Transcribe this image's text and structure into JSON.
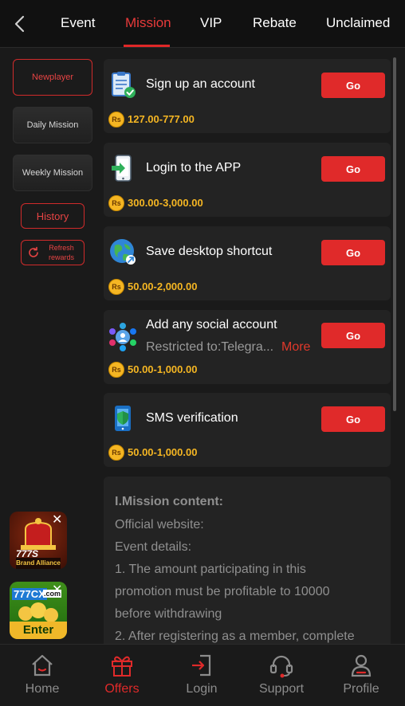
{
  "header": {
    "tabs": [
      {
        "label": "Event"
      },
      {
        "label": "Mission"
      },
      {
        "label": "VIP"
      },
      {
        "label": "Rebate"
      },
      {
        "label": "Unclaimed"
      }
    ],
    "active_tab": "Mission"
  },
  "sidebar": {
    "items": [
      {
        "label": "Newplayer"
      },
      {
        "label": "Daily Mission"
      },
      {
        "label": "Weekly Mission"
      }
    ],
    "history_label": "History",
    "refresh_label": "Refresh rewards"
  },
  "missions": [
    {
      "title": "Sign up an account",
      "button": "Go",
      "coin": "Rs",
      "reward": "127.00-777.00",
      "icon": "clipboard-check-icon"
    },
    {
      "title": "Login to the APP",
      "button": "Go",
      "coin": "Rs",
      "reward": "300.00-3,000.00",
      "icon": "phone-login-icon"
    },
    {
      "title": "Save desktop shortcut",
      "button": "Go",
      "coin": "Rs",
      "reward": "50.00-2,000.00",
      "icon": "globe-shortcut-icon"
    },
    {
      "title": "Add any social account",
      "subtitle": "Restricted to:Telegra...",
      "more": "More",
      "button": "Go",
      "coin": "Rs",
      "reward": "50.00-1,000.00",
      "icon": "social-network-icon"
    },
    {
      "title": "SMS verification",
      "button": "Go",
      "coin": "Rs",
      "reward": "50.00-1,000.00",
      "icon": "phone-shield-icon"
    }
  ],
  "content": {
    "heading": "I.Mission content:",
    "lines": [
      "Official website:",
      "Event details:",
      "1. The amount participating in this",
      "promotion must be profitable to 10000",
      "before withdrawing",
      "2. After registering as a member, complete"
    ]
  },
  "promos": [
    {
      "text": "777S",
      "tag": "Brand Alliance",
      "close": "✕"
    },
    {
      "text": "777CX",
      "domain": ".com",
      "cta": "Enter",
      "close": "✕"
    }
  ],
  "bottom_nav": [
    {
      "label": "Home",
      "icon": "home-icon"
    },
    {
      "label": "Offers",
      "icon": "gift-icon"
    },
    {
      "label": "Login",
      "icon": "login-icon"
    },
    {
      "label": "Support",
      "icon": "headset-icon"
    },
    {
      "label": "Profile",
      "icon": "user-icon"
    }
  ],
  "colors": {
    "accent": "#e02a2a",
    "gold": "#f5b623",
    "background": "#1a1a1a",
    "card": "#232323"
  }
}
